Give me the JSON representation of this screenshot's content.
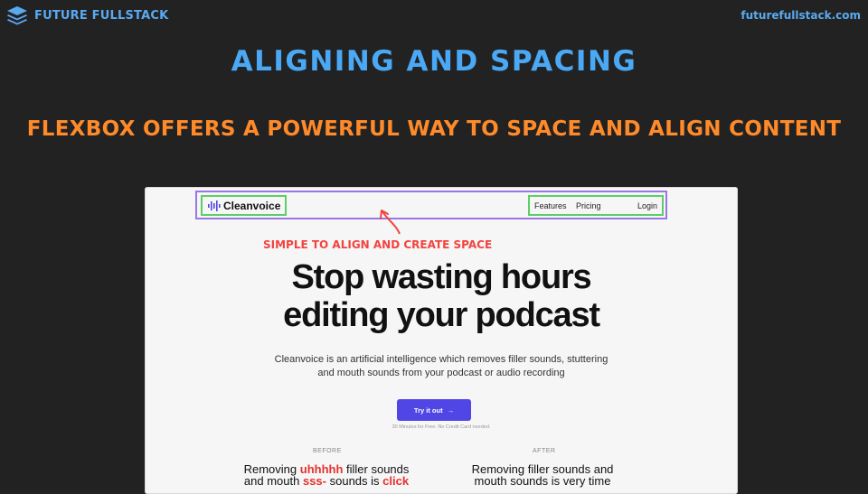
{
  "header": {
    "brand": "FUTURE FULLSTACK",
    "url": "futurefullstack.com"
  },
  "title": "ALIGNING AND SPACING",
  "subtitle": "FLEXBOX OFFERS A POWERFUL WAY TO SPACE AND ALIGN CONTENT",
  "screenshot": {
    "logo": "Cleanvoice",
    "nav": [
      "Features",
      "Pricing",
      "Login"
    ],
    "annotation": "SIMPLE TO ALIGN AND CREATE SPACE",
    "hero_line1": "Stop wasting hours",
    "hero_line2": "editing your podcast",
    "desc_line1": "Cleanvoice is an artificial intelligence which removes filler sounds, stuttering",
    "desc_line2": "and mouth sounds from your podcast or audio recording",
    "cta": "Try it out",
    "cta_arrow": "→",
    "fine_print": "30 Minutes for Free. No Credit Card needed.",
    "before_label": "BEFORE",
    "after_label": "AFTER",
    "before": {
      "a": "Removing ",
      "b": "uhhhhh",
      "c": " filler sounds",
      "d": "and mouth ",
      "e": "sss-",
      "f": " sounds is ",
      "g": "click"
    },
    "after": {
      "line1": "Removing filler sounds and",
      "line2": "mouth sounds is very time"
    }
  },
  "colors": {
    "background": "#222222",
    "title": "#4aa8f5",
    "subtitle": "#ff8a2a",
    "annotation": "#f2433e",
    "nav_outline": "#9b76e6",
    "box_outline": "#5ad064",
    "cta": "#4f46e5"
  },
  "icons": {
    "brand": "layers-stack-icon",
    "logo": "waveform-icon",
    "arrow": "curved-arrow-icon"
  }
}
